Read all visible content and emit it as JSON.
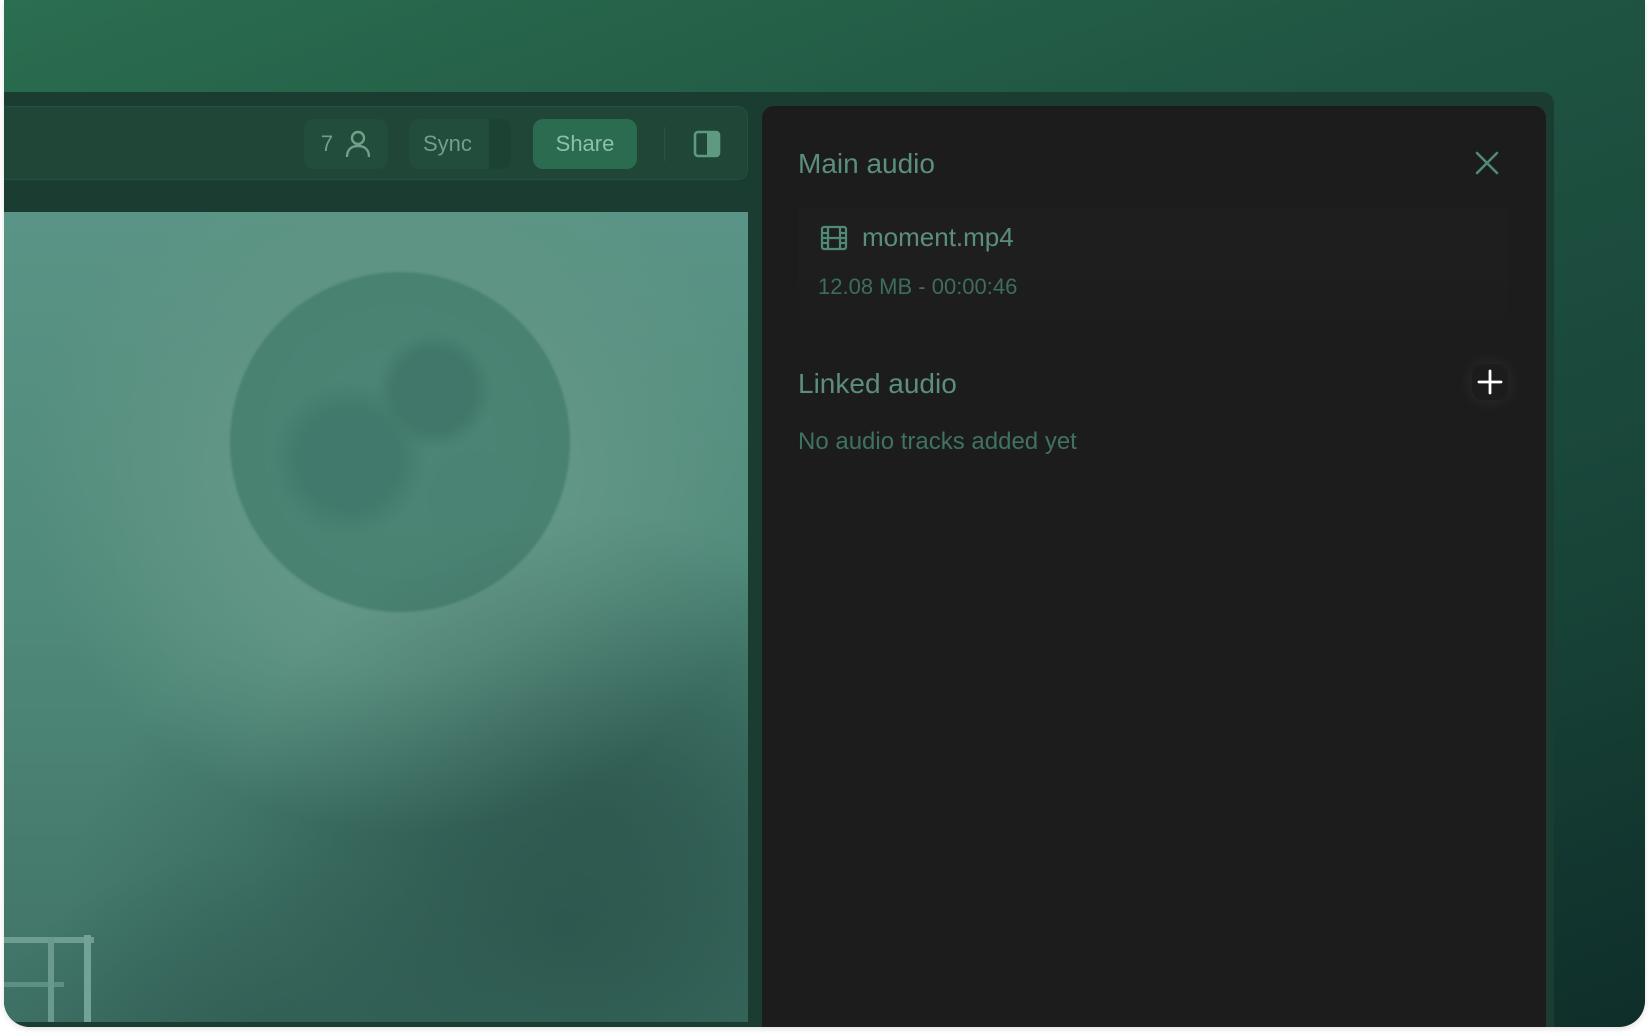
{
  "toolbar": {
    "collaborator_count": "7",
    "collaborator_icon": "user-icon",
    "sync_label": "Sync",
    "share_label": "Share",
    "panel_toggle_icon": "sidebar-toggle-icon"
  },
  "preview": {
    "description_icon": "moon-scene"
  },
  "audio_panel": {
    "title": "Main audio",
    "close_icon": "close-icon",
    "main_file": {
      "icon": "film-icon",
      "name": "moment.mp4",
      "meta": "12.08 MB - 00:00:46"
    },
    "linked_section_title": "Linked audio",
    "add_icon": "plus-icon",
    "empty_message": "No audio tracks added yet"
  },
  "colors": {
    "accent": "#2b6b50",
    "panel_bg": "#1c1c1c",
    "text_muted": "#5b8f7c"
  }
}
